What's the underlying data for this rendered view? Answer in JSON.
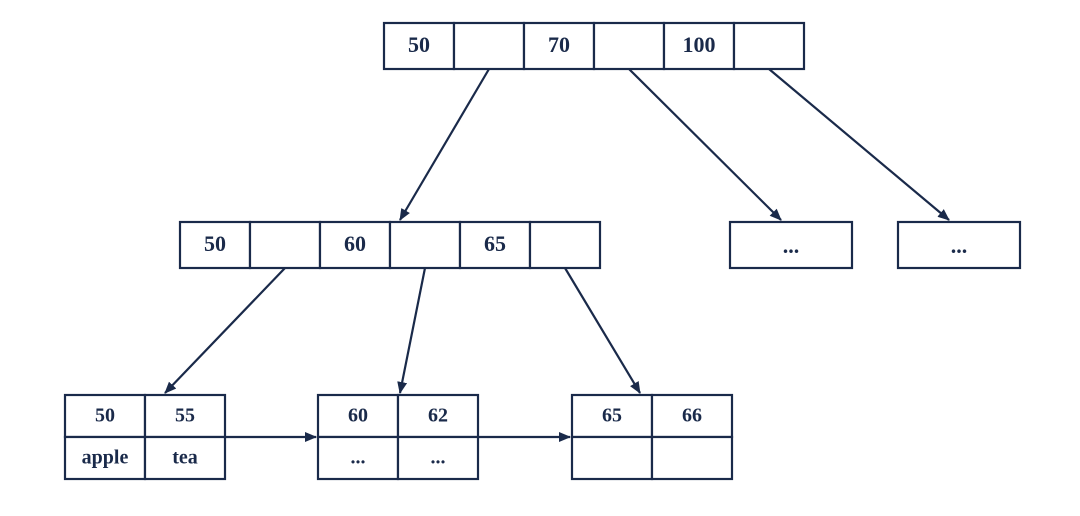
{
  "root": {
    "keys": [
      "50",
      "70",
      "100"
    ]
  },
  "level1": {
    "node0": {
      "keys": [
        "50",
        "60",
        "65"
      ]
    },
    "node1": {
      "label": "..."
    },
    "node2": {
      "label": "..."
    }
  },
  "leaves": {
    "leaf0": {
      "keys": [
        "50",
        "55"
      ],
      "values": [
        "apple",
        "tea"
      ]
    },
    "leaf1": {
      "keys": [
        "60",
        "62"
      ],
      "values": [
        "...",
        "..."
      ]
    },
    "leaf2": {
      "keys": [
        "65",
        "66"
      ],
      "values": [
        "",
        ""
      ]
    }
  }
}
